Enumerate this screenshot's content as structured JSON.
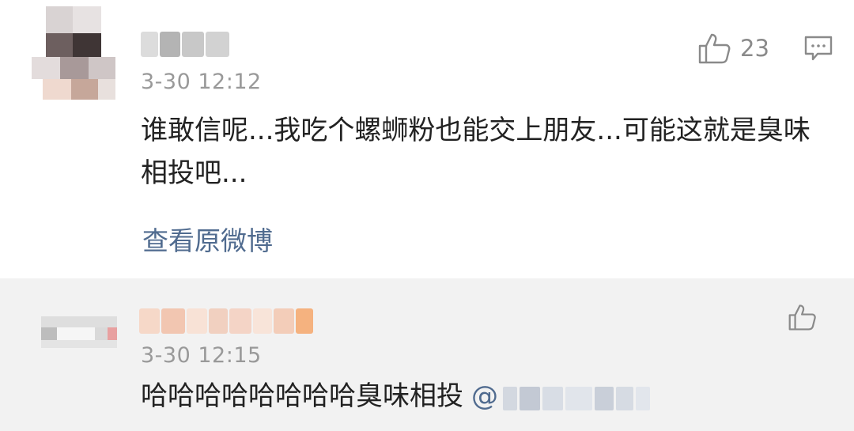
{
  "comments": [
    {
      "timestamp": "3-30 12:12",
      "text": "谁敢信呢...我吃个螺蛳粉也能交上朋友...可能这就是臭味相投吧...",
      "view_original": "查看原微博",
      "like_count": "23",
      "icons": [
        "thumbs-up-icon",
        "comment-icon"
      ]
    },
    {
      "timestamp": "3-30 12:15",
      "text": "哈哈哈哈哈哈哈哈臭味相投",
      "mention_prefix": "@",
      "icons": [
        "thumbs-up-icon"
      ]
    }
  ],
  "colors": {
    "reply_background": "#f2f2f2",
    "link": "#506b8f",
    "meta": "#999999",
    "body_text": "#222222"
  }
}
